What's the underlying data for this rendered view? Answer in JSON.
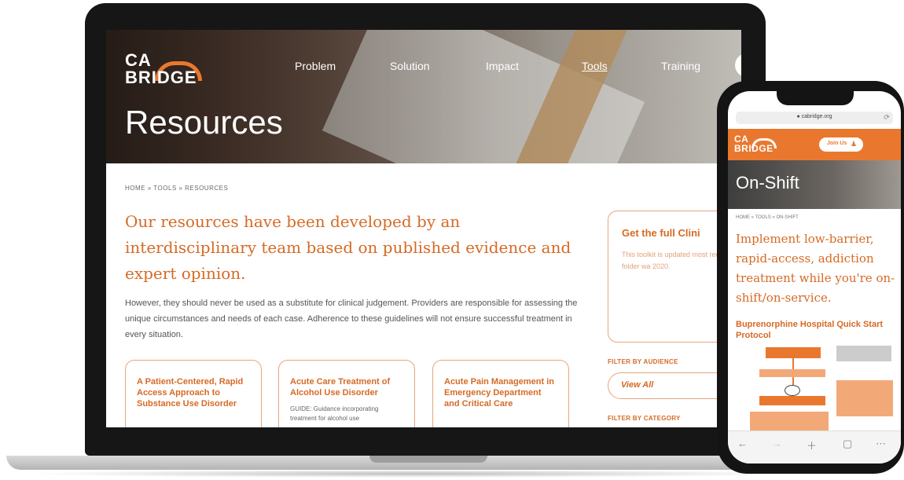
{
  "laptop": {
    "logo": {
      "line1": "CA",
      "line2": "BRIDGE"
    },
    "nav": [
      {
        "label": "Problem"
      },
      {
        "label": "Solution"
      },
      {
        "label": "Impact"
      },
      {
        "label": "Tools"
      },
      {
        "label": "Training"
      }
    ],
    "hero_title": "Resources",
    "breadcrumb": "HOME » TOOLS » RESOURCES",
    "intro_heading": "Our resources have been developed by an interdisciplinary team based on published evidence and expert opinion.",
    "intro_body": "However, they should never be used as a substitute for clinical judgement. Providers are responsible for assessing the unique circumstances and needs of each case. Adherence to these guidelines will not ensure successful treatment in every situation.",
    "cards": [
      {
        "title": "A Patient-Centered, Rapid Access Approach to Substance Use Disorder",
        "desc": ""
      },
      {
        "title": "Acute Care Treatment of Alcohol Use Disorder",
        "desc": "GUIDE: Guidance incorporating treatment for alcohol use"
      },
      {
        "title": "Acute Pain Management in Emergency Department and Critical Care",
        "desc": ""
      }
    ],
    "side_card": {
      "title": "Get the full Clini",
      "body": "This toolkit is updated most recent folder wa 2020."
    },
    "filter_audience_label": "FILTER BY AUDIENCE",
    "filter_audience_value": "View All",
    "filter_category_label": "FILTER BY CATEGORY"
  },
  "phone": {
    "url": "● cabridge.org",
    "logo": {
      "line1": "CA",
      "line2": "BRIDGE"
    },
    "join_label": "Join Us",
    "hero_title": "On-Shift",
    "breadcrumb": "HOME » TOOLS » ON-SHIFT",
    "heading": "Implement low-barrier, rapid-access, addiction treatment while you're on-shift/on-service.",
    "subheading": "Buprenorphine Hospital Quick Start Protocol",
    "toolbar_icons": [
      "back-icon",
      "forward-icon",
      "add-icon",
      "tabs-icon",
      "more-icon"
    ]
  },
  "colors": {
    "accent": "#e9782e",
    "heading": "#d66a25",
    "border": "#e7a57c"
  }
}
